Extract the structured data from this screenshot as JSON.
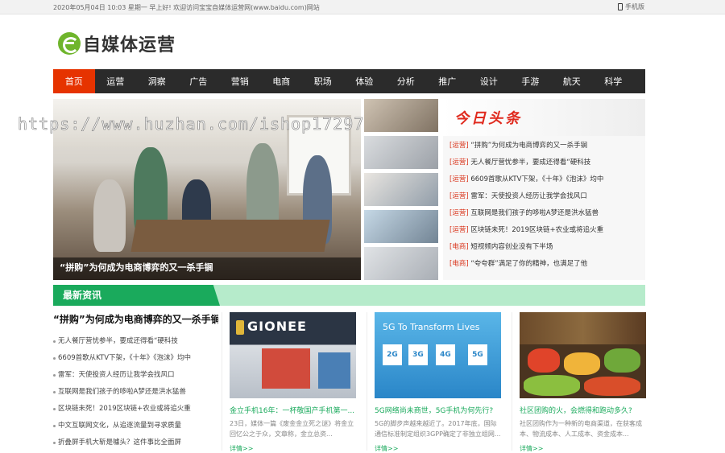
{
  "topbar": {
    "welcome": "2020年05月04日 10:03 星期一 早上好! 欢迎访问宝宝自媒体运营网(www.baidu.com)网站",
    "mobile_label": "手机版",
    "mobile_icon": "phone-icon"
  },
  "logo": {
    "text": "自媒体运营",
    "icon": "e-logo-icon",
    "color": "#6fb52c"
  },
  "nav": {
    "items": [
      "首页",
      "运营",
      "洞察",
      "广告",
      "营销",
      "电商",
      "职场",
      "体验",
      "分析",
      "推广",
      "设计",
      "手游",
      "航天",
      "科学"
    ],
    "active_index": 0,
    "active_color": "#e63300"
  },
  "watermark": "https://www.huzhan.com/ishop17297",
  "hero": {
    "caption": "“拼购”为何成为电商博弈的又一杀手锏"
  },
  "headlines": {
    "title": "今日头条",
    "items": [
      {
        "tag": "[运营]",
        "text": " “拼购”为何成为电商博弈的又一杀手锏"
      },
      {
        "tag": "[运营]",
        "text": " 无人餐厅营忧参半，要成还得看“硬科技"
      },
      {
        "tag": "[运营]",
        "text": " 6609首歌从KTV下架，《十年》《泡沫》均中"
      },
      {
        "tag": "[运营]",
        "text": " 雷军：天使投资人经历让我学会找风口"
      },
      {
        "tag": "[运营]",
        "text": " 互联网是我们孩子的哆啦A梦还是洪水猛兽"
      },
      {
        "tag": "[运营]",
        "text": " 区块链未死！2019区块链+农业或将追火重"
      },
      {
        "tag": "[电商]",
        "text": " 短视频内容创业没有下半场"
      },
      {
        "tag": "[电商]",
        "text": " “夸夸群”满足了你的精神，也满足了他"
      }
    ]
  },
  "latest": {
    "title": "最新资讯",
    "lead": "“拼购”为何成为电商博弈的又一杀手锏",
    "items": [
      "无人餐厅营忧参半，要成还得看“硬科技",
      "6609首歌从KTV下架，《十年》《泡沫》均中",
      "雷军：天使投资人经历让我学会找风口",
      "互联网是我们孩子的哆啦A梦还是洪水猛兽",
      "区块链未死！2019区块链+农业或将追火重",
      "中文互联网文化，从追逐流量到寻求质量",
      "折叠屏手机大斩是噱头？这件事比全面屏"
    ]
  },
  "cards": [
    {
      "img_label": "GIONEE",
      "title": "金立手机16年：一杯敬国产手机第一...",
      "desc": "23日，媒体一篇《废金金立死之谜》将金立回忆公之于众，文章称，金立总资...",
      "more": "详情>>"
    },
    {
      "img_label": "5G To Transform Lives",
      "img_sub": [
        "2G",
        "3G",
        "4G",
        "5G"
      ],
      "title": "5G网络尚未商世，5G手机为何先行?",
      "desc": "5G的脚步声越来越近了。2017年底，国际通信标准制定组织3GPP确定了非独立组网...",
      "more": "详情>>"
    },
    {
      "img_label": "",
      "title": "社区团购的火，会燃得和跑动多久?",
      "desc": "社区团购作为一种新的电商渠道，在获客成本、物流成本、人工成本、资金成本...",
      "more": "详情>>"
    }
  ],
  "colors": {
    "green": "#1aaa5c",
    "light_green": "#b6ebcb",
    "dark_nav": "#2b2b2b",
    "red": "#e02a1e"
  }
}
